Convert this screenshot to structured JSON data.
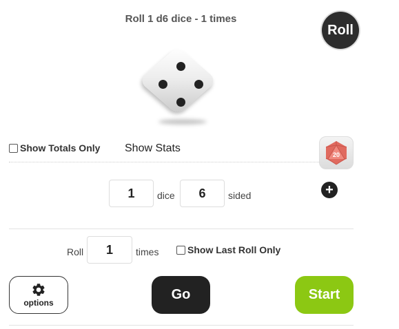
{
  "header": {
    "title": "Roll 1 d6 dice - 1 times",
    "roll_button": "Roll"
  },
  "die": {
    "value": 4,
    "pips": 4
  },
  "options_row": {
    "show_totals_label": "Show Totals Only",
    "show_totals_checked": false,
    "show_stats_label": "Show Stats",
    "d20_icon_label": "20"
  },
  "dice_config": {
    "count": "1",
    "count_label": "dice",
    "sides": "6",
    "sides_label": "sided"
  },
  "roll_config": {
    "roll_label": "Roll",
    "times_value": "1",
    "times_label": "times",
    "show_last_label": "Show Last Roll Only",
    "show_last_checked": false
  },
  "buttons": {
    "options": "options",
    "go": "Go",
    "start": "Start"
  },
  "colors": {
    "dark": "#222222",
    "start_green": "#8cc813",
    "d20_red": "#e06a5f"
  }
}
